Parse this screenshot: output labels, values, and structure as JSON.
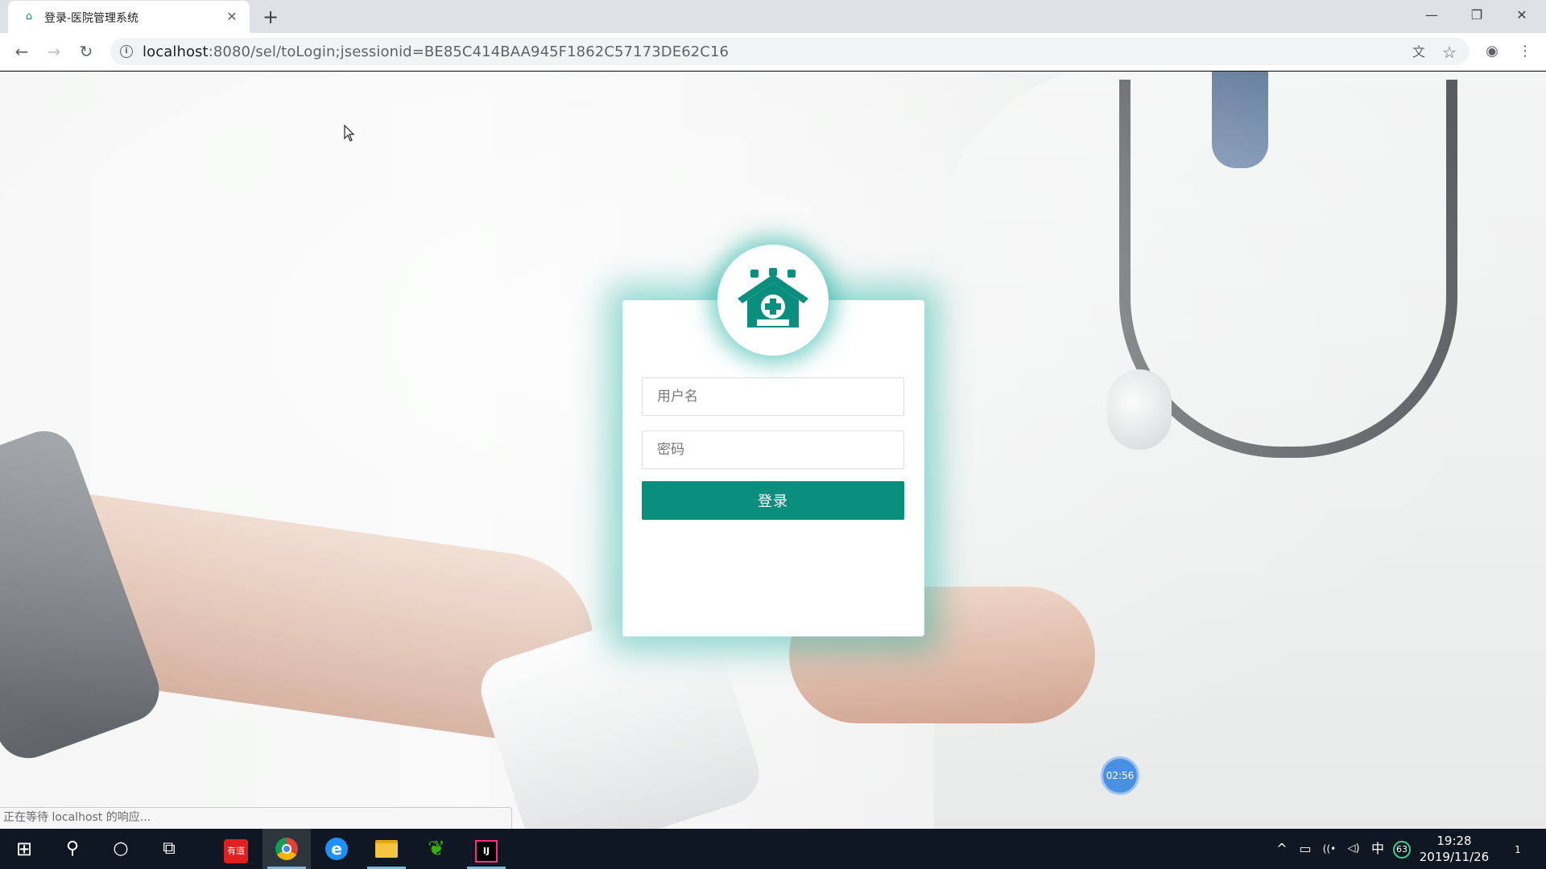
{
  "browser": {
    "tab_title": "登录-医院管理系统",
    "tab_close": "✕",
    "new_tab": "+",
    "url_host": "localhost",
    "url_rest": ":8080/sel/toLogin;jsessionid=BE85C414BAA945F1862C57173DE62C16",
    "window_minimize": "—",
    "window_restore": "❐",
    "window_close": "✕",
    "back": "←",
    "forward": "→",
    "reload": "↻",
    "info_glyph": "i",
    "translate_glyph": "文",
    "star_glyph": "☆",
    "account_glyph": "◉",
    "menu_glyph": "⋮"
  },
  "page": {
    "logo_icon": "hospital-icon",
    "brand_color": "#0a8f7e",
    "glow_color": "#17afa0",
    "username_placeholder": "用户名",
    "password_placeholder": "密码",
    "login_label": "登录",
    "timer_badge": "02:56",
    "status_text": "正在等待 localhost 的响应..."
  },
  "taskbar": {
    "start_glyph": "⊞",
    "search_glyph": "⚲",
    "cortana_glyph": "○",
    "taskview_glyph": "⧉",
    "apps": [
      {
        "name": "youdao-dict",
        "glyph": "有道",
        "color": "#e02020"
      },
      {
        "name": "chrome",
        "glyph": "●",
        "color": "#f2b705"
      },
      {
        "name": "ie",
        "glyph": "e",
        "color": "#1e90ff"
      },
      {
        "name": "file-explorer",
        "glyph": "▬",
        "color": "#f5c542"
      },
      {
        "name": "green-app",
        "glyph": "❦",
        "color": "#38b000"
      },
      {
        "name": "intellij",
        "glyph": "IJ",
        "color": "#ff2e7e"
      }
    ],
    "tray_up": "^",
    "tray_battery": "▭",
    "tray_wifi": "((•",
    "tray_volume": "◁)",
    "tray_ime": "中",
    "tray_badge": "63",
    "time": "19:28",
    "date": "2019/11/26",
    "notifications": "1"
  }
}
